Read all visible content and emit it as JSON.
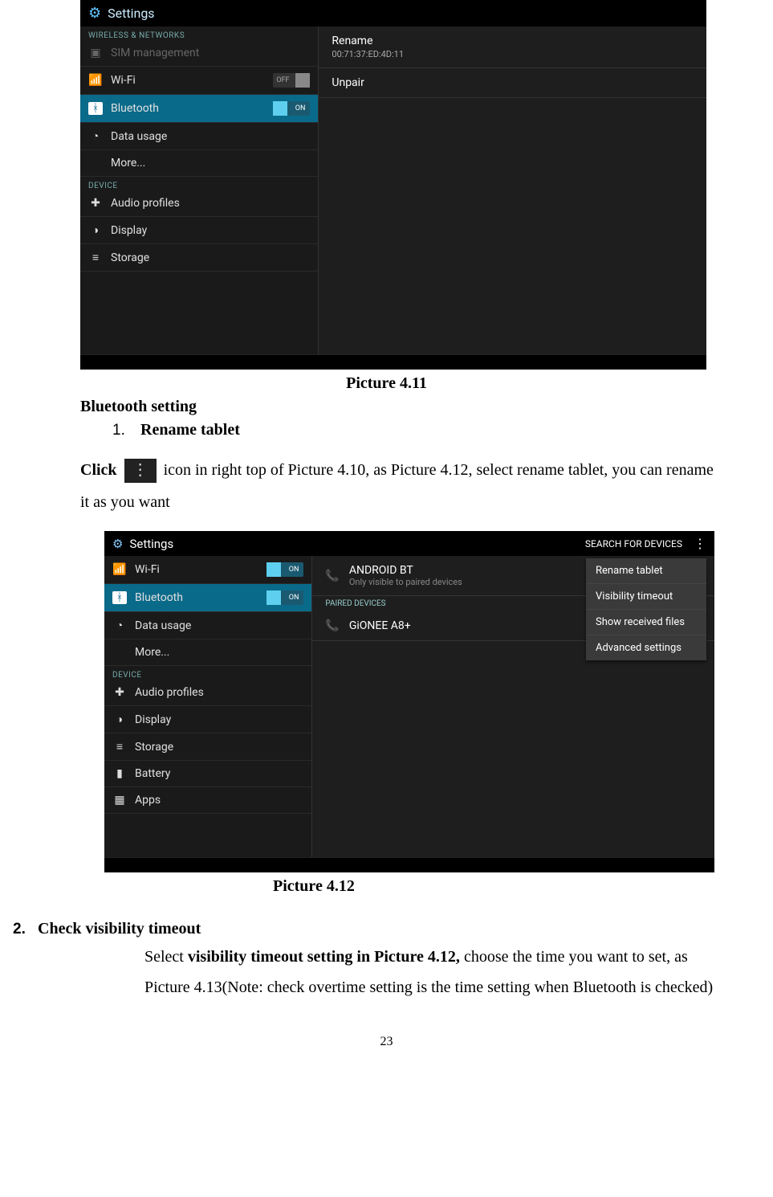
{
  "shot1": {
    "title": "Settings",
    "section_wireless": "WIRELESS & NETWORKS",
    "sim": "SIM management",
    "wifi": "Wi-Fi",
    "wifi_state": "OFF",
    "bluetooth": "Bluetooth",
    "bluetooth_state": "ON",
    "data_usage": "Data usage",
    "more": "More...",
    "section_device": "DEVICE",
    "audio": "Audio profiles",
    "display": "Display",
    "storage": "Storage",
    "rename": "Rename",
    "rename_mac": "00:71:37:ED:4D:11",
    "unpair": "Unpair"
  },
  "caption1": "Picture 4.11",
  "bt_heading": "Bluetooth setting",
  "item1_num": "1.",
  "item1_label": "Rename tablet",
  "para1_click": "Click ",
  "para1_rest": " icon in right top of Picture 4.10, as Picture 4.12, select rename tablet, you can rename it as you want",
  "shot2": {
    "title": "Settings",
    "search": "SEARCH FOR DEVICES",
    "wifi": "Wi-Fi",
    "wifi_state": "ON",
    "bluetooth": "Bluetooth",
    "bluetooth_state": "ON",
    "data_usage": "Data usage",
    "more": "More...",
    "section_device": "DEVICE",
    "audio": "Audio profiles",
    "display": "Display",
    "storage": "Storage",
    "battery": "Battery",
    "apps": "Apps",
    "device_name": "ANDROID BT",
    "device_sub": "Only visible to paired devices",
    "paired": "PAIRED DEVICES",
    "paired_device": "GiONEE A8+",
    "menu1": "Rename tablet",
    "menu2": "Visibility timeout",
    "menu3": "Show received files",
    "menu4": "Advanced settings"
  },
  "caption2": "Picture 4.12",
  "item2_num": "2.",
  "item2_label": "Check visibility timeout",
  "sec2_body_a": "Select ",
  "sec2_body_bold": "visibility timeout setting in Picture 4.12,",
  "sec2_body_b": " choose the time you want to set, as Picture 4.13(Note: check overtime setting is the time setting when Bluetooth is checked)",
  "page_num": "23"
}
